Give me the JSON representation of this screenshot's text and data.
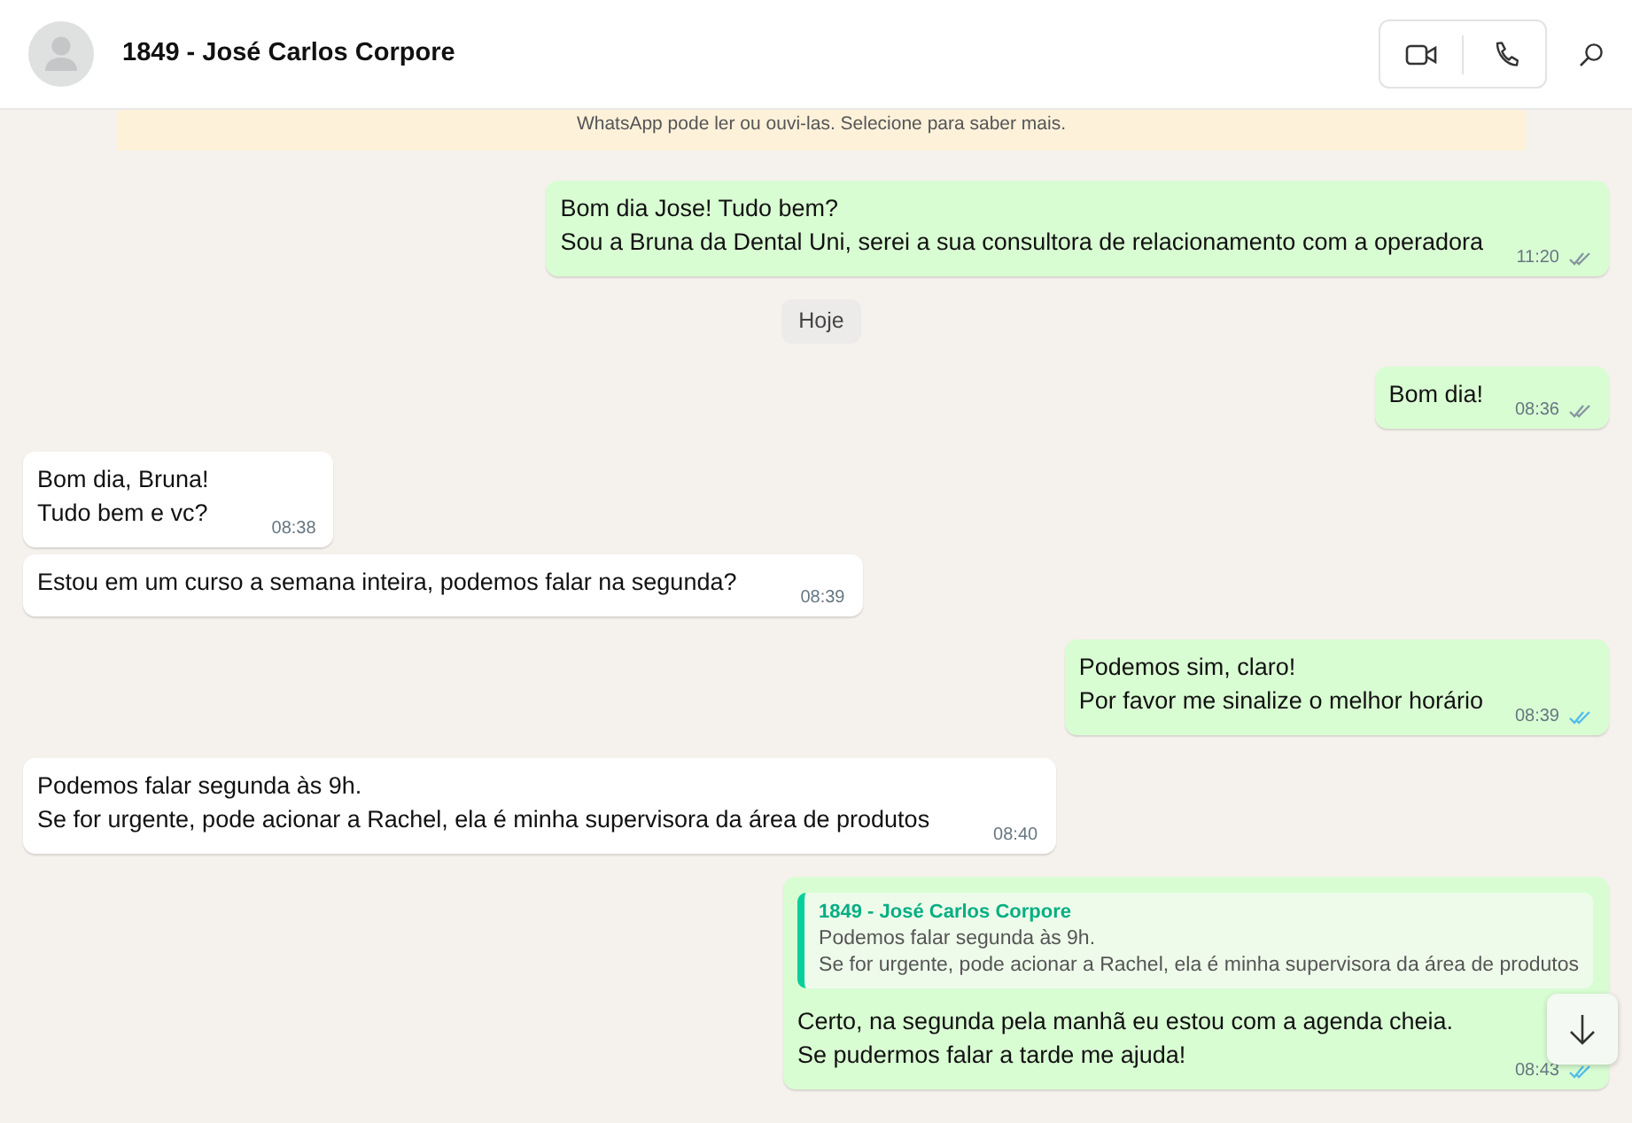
{
  "header": {
    "title": "1849 - José Carlos Corpore"
  },
  "notice": {
    "text": "WhatsApp pode ler ou ouvi-las. Selecione para saber mais."
  },
  "messages": [
    {
      "kind": "outgoing",
      "text": "Bom dia Jose! Tudo bem?\nSou a Bruna da Dental Uni, serei a sua consultora de relacionamento com a operadora",
      "time": "11:20",
      "read": false
    },
    {
      "kind": "date",
      "text": "Hoje"
    },
    {
      "kind": "outgoing",
      "text": "Bom dia!",
      "time": "08:36",
      "read": false
    },
    {
      "kind": "incoming",
      "text": "Bom dia, Bruna!\nTudo bem e vc?",
      "time": "08:38"
    },
    {
      "kind": "incoming",
      "text": "Estou em um curso a semana inteira, podemos falar na segunda?",
      "time": "08:39"
    },
    {
      "kind": "outgoing",
      "text": "Podemos sim, claro!\nPor favor me sinalize o melhor horário",
      "time": "08:39",
      "read": true
    },
    {
      "kind": "incoming",
      "text": "Podemos falar segunda às 9h.\nSe for urgente, pode acionar a Rachel, ela é minha supervisora da área de produtos",
      "time": "08:40"
    },
    {
      "kind": "outgoing",
      "quote": {
        "author": "1849 - José Carlos Corpore",
        "text": "Podemos falar segunda às 9h.\nSe for urgente, pode acionar a Rachel, ela é minha supervisora da área de produtos"
      },
      "text": "Certo, na segunda pela manhã eu estou com a agenda cheia.\nSe pudermos falar a tarde me ajuda!",
      "time": "08:43",
      "read": true
    }
  ]
}
